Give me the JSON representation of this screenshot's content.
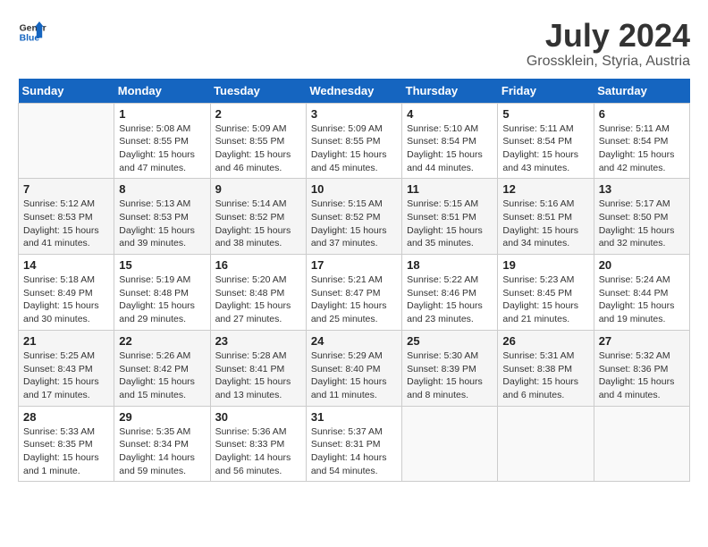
{
  "header": {
    "logo_line1": "General",
    "logo_line2": "Blue",
    "month_year": "July 2024",
    "location": "Grossklein, Styria, Austria"
  },
  "weekdays": [
    "Sunday",
    "Monday",
    "Tuesday",
    "Wednesday",
    "Thursday",
    "Friday",
    "Saturday"
  ],
  "weeks": [
    [
      {
        "day": "",
        "info": ""
      },
      {
        "day": "1",
        "info": "Sunrise: 5:08 AM\nSunset: 8:55 PM\nDaylight: 15 hours\nand 47 minutes."
      },
      {
        "day": "2",
        "info": "Sunrise: 5:09 AM\nSunset: 8:55 PM\nDaylight: 15 hours\nand 46 minutes."
      },
      {
        "day": "3",
        "info": "Sunrise: 5:09 AM\nSunset: 8:55 PM\nDaylight: 15 hours\nand 45 minutes."
      },
      {
        "day": "4",
        "info": "Sunrise: 5:10 AM\nSunset: 8:54 PM\nDaylight: 15 hours\nand 44 minutes."
      },
      {
        "day": "5",
        "info": "Sunrise: 5:11 AM\nSunset: 8:54 PM\nDaylight: 15 hours\nand 43 minutes."
      },
      {
        "day": "6",
        "info": "Sunrise: 5:11 AM\nSunset: 8:54 PM\nDaylight: 15 hours\nand 42 minutes."
      }
    ],
    [
      {
        "day": "7",
        "info": "Sunrise: 5:12 AM\nSunset: 8:53 PM\nDaylight: 15 hours\nand 41 minutes."
      },
      {
        "day": "8",
        "info": "Sunrise: 5:13 AM\nSunset: 8:53 PM\nDaylight: 15 hours\nand 39 minutes."
      },
      {
        "day": "9",
        "info": "Sunrise: 5:14 AM\nSunset: 8:52 PM\nDaylight: 15 hours\nand 38 minutes."
      },
      {
        "day": "10",
        "info": "Sunrise: 5:15 AM\nSunset: 8:52 PM\nDaylight: 15 hours\nand 37 minutes."
      },
      {
        "day": "11",
        "info": "Sunrise: 5:15 AM\nSunset: 8:51 PM\nDaylight: 15 hours\nand 35 minutes."
      },
      {
        "day": "12",
        "info": "Sunrise: 5:16 AM\nSunset: 8:51 PM\nDaylight: 15 hours\nand 34 minutes."
      },
      {
        "day": "13",
        "info": "Sunrise: 5:17 AM\nSunset: 8:50 PM\nDaylight: 15 hours\nand 32 minutes."
      }
    ],
    [
      {
        "day": "14",
        "info": "Sunrise: 5:18 AM\nSunset: 8:49 PM\nDaylight: 15 hours\nand 30 minutes."
      },
      {
        "day": "15",
        "info": "Sunrise: 5:19 AM\nSunset: 8:48 PM\nDaylight: 15 hours\nand 29 minutes."
      },
      {
        "day": "16",
        "info": "Sunrise: 5:20 AM\nSunset: 8:48 PM\nDaylight: 15 hours\nand 27 minutes."
      },
      {
        "day": "17",
        "info": "Sunrise: 5:21 AM\nSunset: 8:47 PM\nDaylight: 15 hours\nand 25 minutes."
      },
      {
        "day": "18",
        "info": "Sunrise: 5:22 AM\nSunset: 8:46 PM\nDaylight: 15 hours\nand 23 minutes."
      },
      {
        "day": "19",
        "info": "Sunrise: 5:23 AM\nSunset: 8:45 PM\nDaylight: 15 hours\nand 21 minutes."
      },
      {
        "day": "20",
        "info": "Sunrise: 5:24 AM\nSunset: 8:44 PM\nDaylight: 15 hours\nand 19 minutes."
      }
    ],
    [
      {
        "day": "21",
        "info": "Sunrise: 5:25 AM\nSunset: 8:43 PM\nDaylight: 15 hours\nand 17 minutes."
      },
      {
        "day": "22",
        "info": "Sunrise: 5:26 AM\nSunset: 8:42 PM\nDaylight: 15 hours\nand 15 minutes."
      },
      {
        "day": "23",
        "info": "Sunrise: 5:28 AM\nSunset: 8:41 PM\nDaylight: 15 hours\nand 13 minutes."
      },
      {
        "day": "24",
        "info": "Sunrise: 5:29 AM\nSunset: 8:40 PM\nDaylight: 15 hours\nand 11 minutes."
      },
      {
        "day": "25",
        "info": "Sunrise: 5:30 AM\nSunset: 8:39 PM\nDaylight: 15 hours\nand 8 minutes."
      },
      {
        "day": "26",
        "info": "Sunrise: 5:31 AM\nSunset: 8:38 PM\nDaylight: 15 hours\nand 6 minutes."
      },
      {
        "day": "27",
        "info": "Sunrise: 5:32 AM\nSunset: 8:36 PM\nDaylight: 15 hours\nand 4 minutes."
      }
    ],
    [
      {
        "day": "28",
        "info": "Sunrise: 5:33 AM\nSunset: 8:35 PM\nDaylight: 15 hours\nand 1 minute."
      },
      {
        "day": "29",
        "info": "Sunrise: 5:35 AM\nSunset: 8:34 PM\nDaylight: 14 hours\nand 59 minutes."
      },
      {
        "day": "30",
        "info": "Sunrise: 5:36 AM\nSunset: 8:33 PM\nDaylight: 14 hours\nand 56 minutes."
      },
      {
        "day": "31",
        "info": "Sunrise: 5:37 AM\nSunset: 8:31 PM\nDaylight: 14 hours\nand 54 minutes."
      },
      {
        "day": "",
        "info": ""
      },
      {
        "day": "",
        "info": ""
      },
      {
        "day": "",
        "info": ""
      }
    ]
  ]
}
